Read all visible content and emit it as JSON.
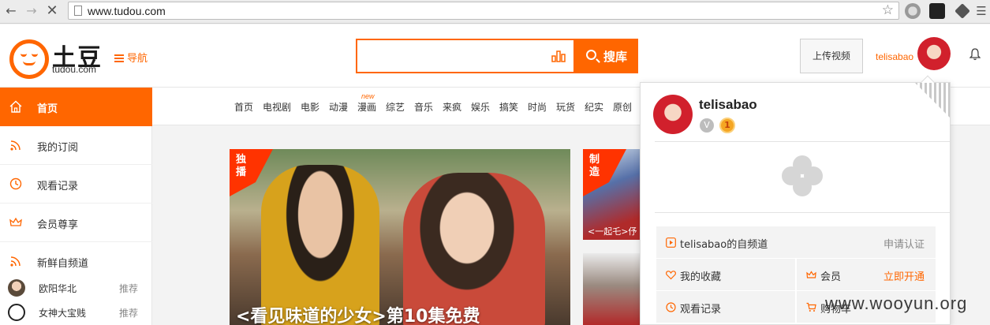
{
  "browser": {
    "url": "www.tudou.com"
  },
  "header": {
    "logo_title": "土豆",
    "logo_domain": "tudou.com",
    "nav_label": "导航",
    "search_placeholder": "",
    "search_button": "搜库",
    "upload_button": "上传视频",
    "username": "telisabao"
  },
  "sidebar": {
    "items": [
      {
        "label": "首页",
        "icon": "home-icon"
      },
      {
        "label": "我的订阅",
        "icon": "rss-icon"
      },
      {
        "label": "观看记录",
        "icon": "clock-icon"
      },
      {
        "label": "会员尊享",
        "icon": "crown-icon"
      },
      {
        "label": "新鲜自频道",
        "icon": "rss-icon"
      }
    ],
    "subscriptions": [
      {
        "name": "欧阳华北",
        "tag": "推荐"
      },
      {
        "name": "女神大宝贱",
        "tag": "推荐"
      }
    ]
  },
  "categories": [
    "首页",
    "电视剧",
    "电影",
    "动漫",
    "漫画",
    "综艺",
    "音乐",
    "来疯",
    "娱乐",
    "搞笑",
    "时尚",
    "玩货",
    "纪实",
    "原创"
  ],
  "new_tag": "new",
  "banner": {
    "badge": "独播",
    "caption": "<看见味道的少女>第10集免费"
  },
  "side_banner": {
    "badge": "制造",
    "caption": "<一起乇>伃"
  },
  "dropdown": {
    "username": "telisabao",
    "v_badge": "V",
    "level": "1",
    "rows": [
      {
        "label": "telisabao的自频道",
        "action": "申请认证"
      },
      {
        "label": "我的收藏"
      },
      {
        "label": "会员",
        "action": "立即开通"
      },
      {
        "label": "观看记录"
      },
      {
        "label": "购物车"
      }
    ]
  },
  "watermark": "www.wooyun.org",
  "colors": {
    "brand": "#ff6600",
    "accent_red": "#ff3300"
  }
}
